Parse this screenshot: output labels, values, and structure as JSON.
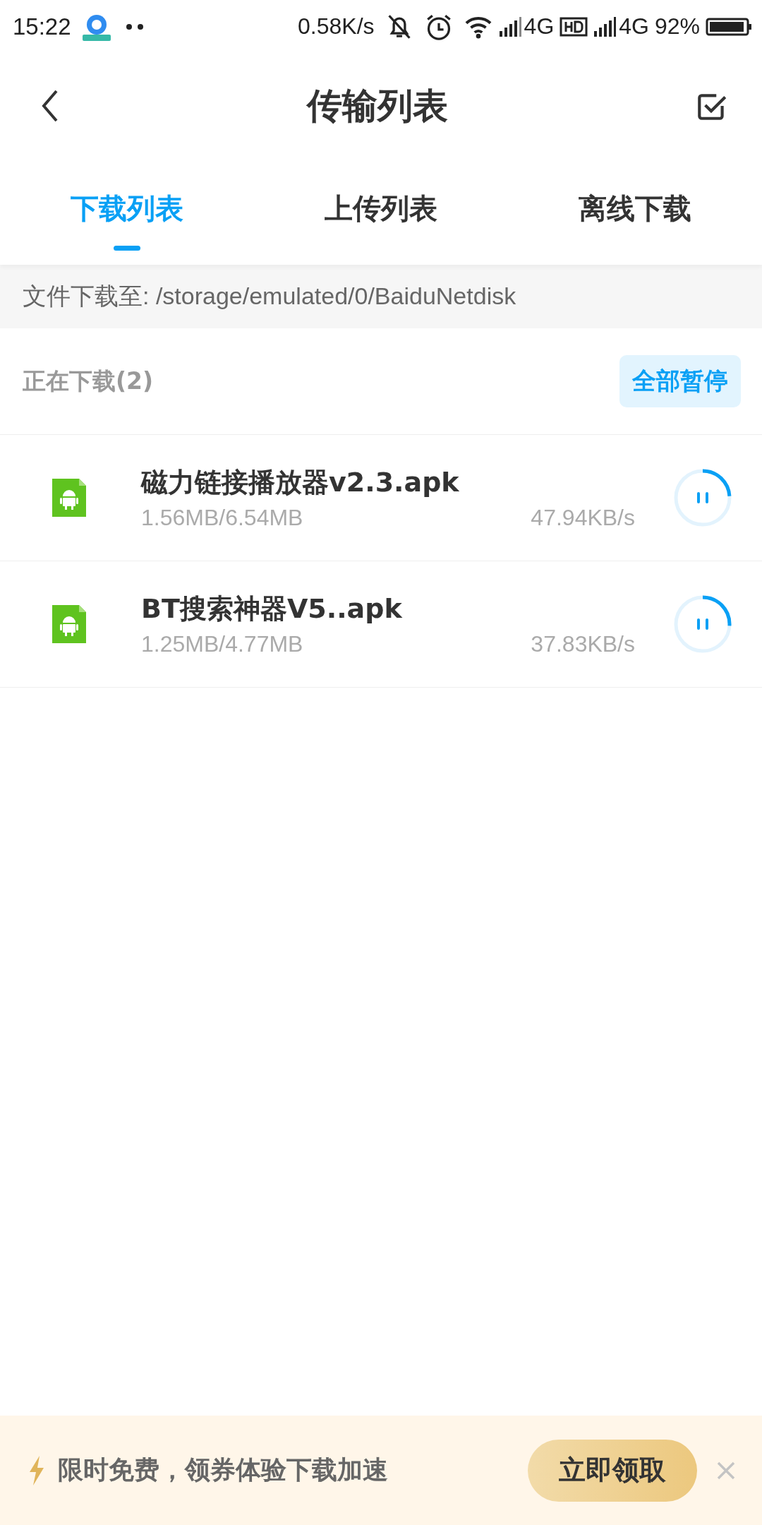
{
  "status_bar": {
    "time": "15:22",
    "net_speed": "0.58K/s",
    "network_1": "4G",
    "network_2": "4G",
    "battery": "92%"
  },
  "header": {
    "title": "传输列表"
  },
  "tabs": [
    {
      "label": "下载列表",
      "selected": true
    },
    {
      "label": "上传列表",
      "selected": false
    },
    {
      "label": "离线下载",
      "selected": false
    }
  ],
  "path_bar": {
    "text": "文件下载至: /storage/emulated/0/BaiduNetdisk"
  },
  "section": {
    "title": "正在下载(2)",
    "action": "全部暂停"
  },
  "downloads": [
    {
      "name": "磁力链接播放器v2.3.apk",
      "size": "1.56MB/6.54MB",
      "speed": "47.94KB/s",
      "level": 0.24
    },
    {
      "name": "BT搜索神器V5..apk",
      "size": "1.25MB/4.77MB",
      "speed": "37.83KB/s",
      "level": 0.26
    }
  ],
  "promo": {
    "text": "限时免费，领券体验下载加速",
    "button": "立即领取"
  }
}
